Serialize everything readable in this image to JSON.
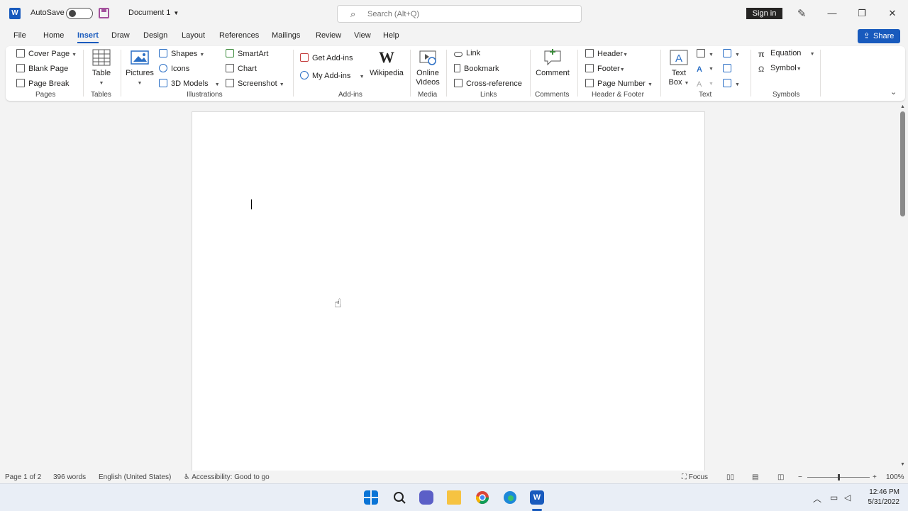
{
  "titlebar": {
    "app_logo": "W",
    "autosave_label": "AutoSave",
    "autosave_state": "off",
    "document_title": "Document 1",
    "search_placeholder": "Search (Alt+Q)",
    "signin_label": "Sign in",
    "window_controls": [
      "minimize-icon",
      "restore-icon",
      "close-icon"
    ]
  },
  "menu": {
    "tabs": [
      "File",
      "Home",
      "Insert",
      "Draw",
      "Design",
      "Layout",
      "References",
      "Mailings",
      "Review",
      "View",
      "Help"
    ],
    "active_tab": "Insert",
    "share_label": "Share"
  },
  "ribbon": {
    "pages": {
      "label": "Pages",
      "items": [
        "Cover Page",
        "Blank Page",
        "Page Break"
      ]
    },
    "tables": {
      "label": "Tables",
      "table": "Table"
    },
    "illustrations": {
      "label": "Illustrations",
      "pictures": "Pictures",
      "shapes": "Shapes",
      "icons": "Icons",
      "models": "3D Models",
      "smartart": "SmartArt",
      "chart": "Chart",
      "screenshot": "Screenshot"
    },
    "addins": {
      "label": "Add-ins",
      "get": "Get Add-ins",
      "my": "My Add-ins",
      "wikipedia": "Wikipedia",
      "wiki_logo": "W"
    },
    "media": {
      "label": "Media",
      "online1": "Online",
      "online2": "Videos"
    },
    "links": {
      "label": "Links",
      "link": "Link",
      "bookmark": "Bookmark",
      "crossref": "Cross-reference"
    },
    "comments": {
      "label": "Comments",
      "comment": "Comment"
    },
    "header_footer": {
      "label": "Header & Footer",
      "header": "Header",
      "footer": "Footer",
      "page_number": "Page Number"
    },
    "text": {
      "label": "Text",
      "textbox1": "Text",
      "textbox2": "Box"
    },
    "symbols": {
      "label": "Symbols",
      "equation": "Equation",
      "symbol": "Symbol"
    }
  },
  "status": {
    "page": "Page 1 of 2",
    "words": "396 words",
    "language": "English (United States)",
    "accessibility": "Accessibility: Good to go",
    "focus": "Focus",
    "zoom": "100%",
    "zoom_fraction": 0.5
  },
  "taskbar": {
    "time": "12:46 PM",
    "date": "5/31/2022",
    "apps": [
      "start-icon",
      "search-icon",
      "teams-icon",
      "file-explorer-icon",
      "chrome-icon",
      "edge-icon",
      "word-icon"
    ]
  },
  "colors": {
    "accent": "#185abd",
    "ribbon_bg": "#ffffff",
    "app_bg": "#f3f3f3"
  }
}
